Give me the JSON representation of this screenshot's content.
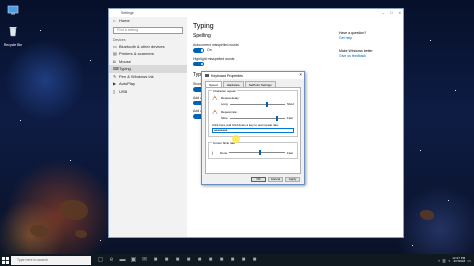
{
  "desktop": {
    "icons": [
      {
        "label": "",
        "icon": "monitor-icon"
      },
      {
        "label": "Recycle Bin",
        "icon": "recycle-bin-icon"
      }
    ]
  },
  "settings": {
    "title": "Settings",
    "search_placeholder": "Find a setting",
    "home_label": "Home",
    "section_label": "Devices",
    "nav_items": [
      {
        "label": "Bluetooth & other devices",
        "icon": "bluetooth-icon",
        "active": false
      },
      {
        "label": "Printers & scanners",
        "icon": "printer-icon",
        "active": false
      },
      {
        "label": "Mouse",
        "icon": "mouse-icon",
        "active": false
      },
      {
        "label": "Typing",
        "icon": "keyboard-icon",
        "active": true
      },
      {
        "label": "Pen & Windows Ink",
        "icon": "pen-icon",
        "active": false
      },
      {
        "label": "AutoPlay",
        "icon": "autoplay-icon",
        "active": false
      },
      {
        "label": "USB",
        "icon": "usb-icon",
        "active": false
      }
    ],
    "page_title": "Typing",
    "spelling_heading": "Spelling",
    "autocorrect_label": "Autocorrect misspelled words",
    "autocorrect_state": "On",
    "highlight_label": "Highlight misspelled words",
    "typing_heading": "Typing",
    "typing_opts": [
      "Show",
      "Add a",
      "Add a"
    ],
    "right": {
      "question_title": "Have a question?",
      "question_link": "Get help",
      "improve_title": "Make Windows better",
      "improve_link": "Give us feedback"
    }
  },
  "dialog": {
    "title": "Keyboard Properties",
    "tabs": [
      "Speed",
      "Hardware",
      "SetPoint Settings"
    ],
    "char_repeat_label": "Character repeat",
    "delay_label": "Repeat delay:",
    "delay_min": "Long",
    "delay_max": "Short",
    "delay_value": 0.67,
    "rate_label": "Repeat rate:",
    "rate_min": "Slow",
    "rate_max": "Fast",
    "rate_value": 0.85,
    "test_label": "Click here and hold down a key to test repeat rate:",
    "test_value": "aaaaaaaa",
    "cursor_label": "Cursor blink rate",
    "cursor_min": "None",
    "cursor_max": "Fast",
    "cursor_value": 0.55,
    "ok": "OK",
    "cancel": "Cancel",
    "apply": "Apply"
  },
  "taskbar": {
    "search_placeholder": "Type here to search",
    "pinned": [
      "task-view-icon",
      "edge-icon",
      "explorer-icon",
      "store-icon",
      "mail-icon",
      "app-icon",
      "app-icon",
      "app-icon",
      "app-icon",
      "app-icon",
      "app-icon",
      "app-icon",
      "app-icon",
      "app-icon",
      "app-icon"
    ],
    "time": "12:27 PM",
    "date": "4/7/2018"
  },
  "colors": {
    "accent": "#0063b1",
    "taskbar": "#101820",
    "nav_bg": "#f2f2f2"
  }
}
